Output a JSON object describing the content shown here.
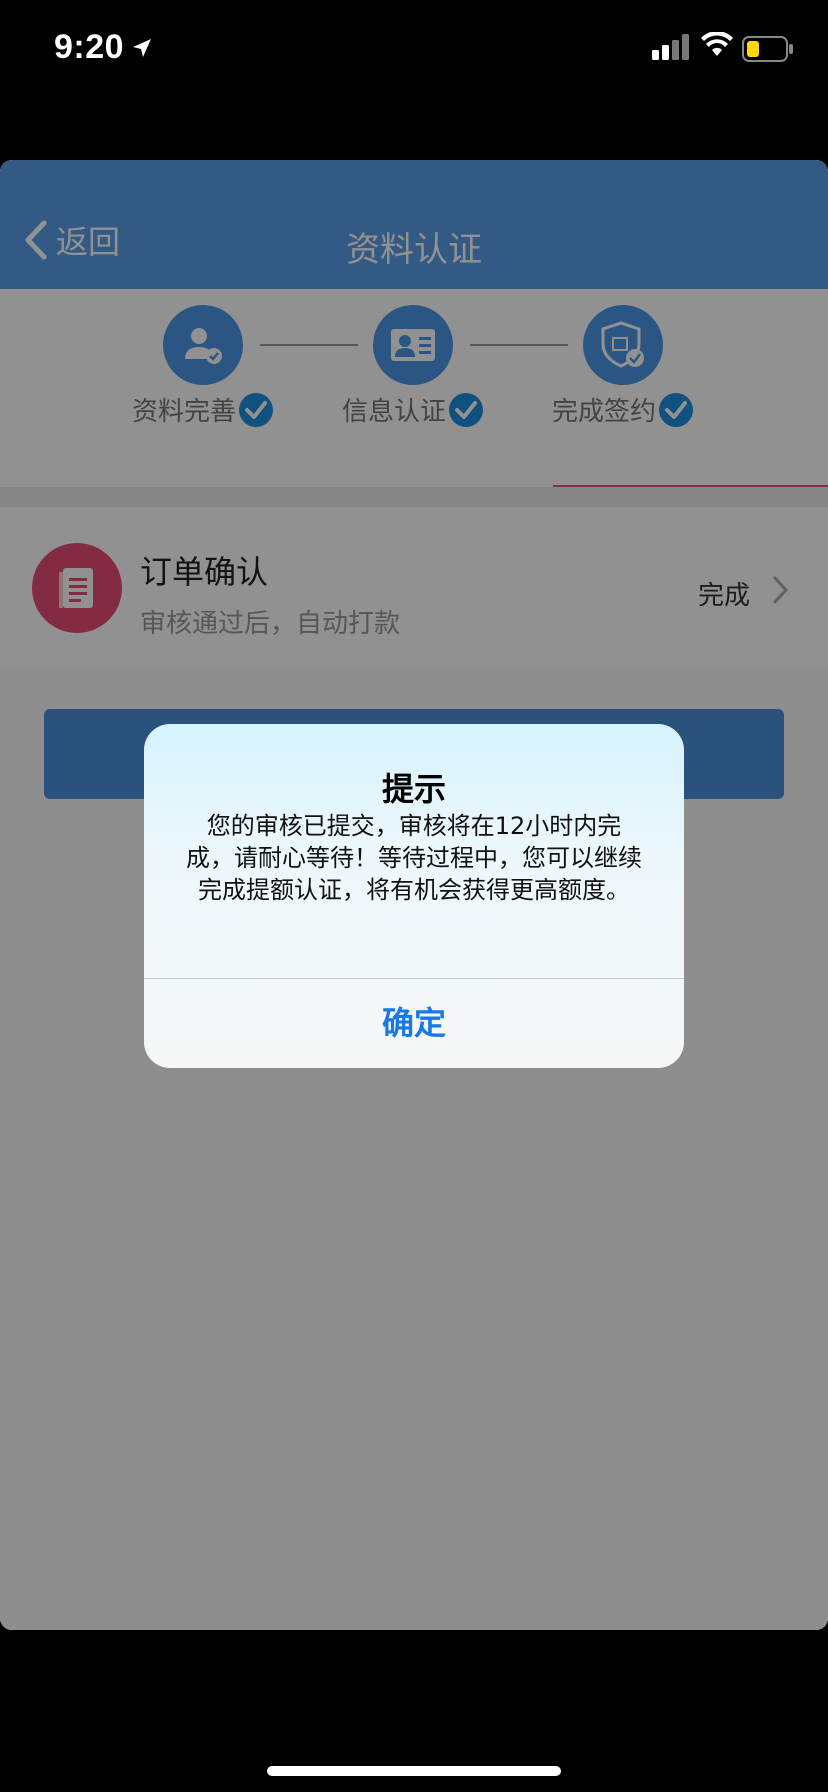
{
  "status_bar": {
    "time": "9:20"
  },
  "navbar": {
    "back_label": "返回",
    "title": "资料认证"
  },
  "steps": [
    {
      "label": "资料完善",
      "icon": "user-check-icon"
    },
    {
      "label": "信息认证",
      "icon": "id-card-icon"
    },
    {
      "label": "完成签约",
      "icon": "shield-check-icon"
    }
  ],
  "order": {
    "title": "订单确认",
    "subtitle": "审核通过后，自动打款",
    "status": "完成"
  },
  "alert": {
    "title": "提示",
    "message": "您的审核已提交，审核将在12小时内完成，请耐心等待！等待过程中，您可以继续完成提额认证，将有机会获得更高额度。",
    "confirm": "确定"
  },
  "colors": {
    "primary": "#5a9ee8",
    "order_icon": "#e84d78",
    "alert_button": "#1778e6"
  }
}
